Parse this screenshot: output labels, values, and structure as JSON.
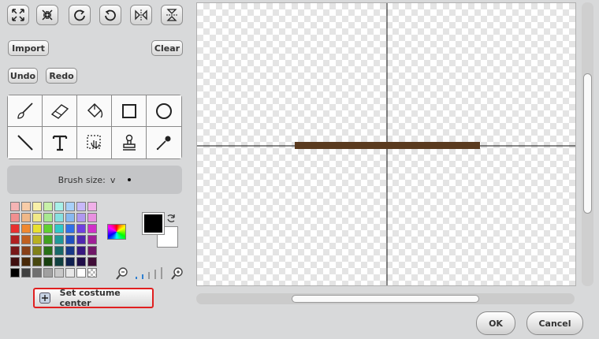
{
  "toolbar": {
    "top_icons": [
      "grow-icon",
      "shrink-icon",
      "rotate-right-icon",
      "rotate-left-icon",
      "flip-horizontal-icon",
      "flip-vertical-icon"
    ],
    "import_label": "Import",
    "clear_label": "Clear",
    "undo_label": "Undo",
    "redo_label": "Redo"
  },
  "tools": [
    "paintbrush-tool",
    "eraser-tool",
    "fill-tool",
    "rectangle-tool",
    "ellipse-tool",
    "line-tool",
    "text-tool",
    "select-tool",
    "stamp-tool",
    "eyedropper-tool"
  ],
  "options": {
    "brush_label": "Brush size:",
    "brush_dropdown": "v"
  },
  "colors": {
    "foreground": "#000000",
    "background": "#ffffff",
    "stroke": "#5a3a1e",
    "palette": [
      [
        "#f4b4b4",
        "#f8cca8",
        "#f8f0a8",
        "#c8f0a8",
        "#a8f0e8",
        "#a8d0f8",
        "#c8b8f8",
        "#f0b0e8"
      ],
      [
        "#f09090",
        "#f0b888",
        "#f0e888",
        "#a8e890",
        "#88e0e0",
        "#88b8f0",
        "#b098f0",
        "#e890e0"
      ],
      [
        "#e83030",
        "#f08830",
        "#e8e030",
        "#60d030",
        "#30c8c8",
        "#3070e8",
        "#7040e0",
        "#d030c8"
      ],
      [
        "#b02020",
        "#c06020",
        "#b8b020",
        "#40a020",
        "#209898",
        "#2050c0",
        "#5028b0",
        "#a02098"
      ],
      [
        "#781818",
        "#884018",
        "#808018",
        "#287018",
        "#186868",
        "#183888",
        "#381880",
        "#701868"
      ],
      [
        "#401010",
        "#482808",
        "#484810",
        "#184010",
        "#104040",
        "#102050",
        "#200e48",
        "#400e38"
      ],
      [
        "#000000",
        "#404040",
        "#707070",
        "#a0a0a0",
        "#c8c8c8",
        "#e8e8e8",
        "#ffffff",
        "checker"
      ]
    ]
  },
  "costume_center_label": "Set costume center",
  "dialog": {
    "ok_label": "OK",
    "cancel_label": "Cancel"
  }
}
